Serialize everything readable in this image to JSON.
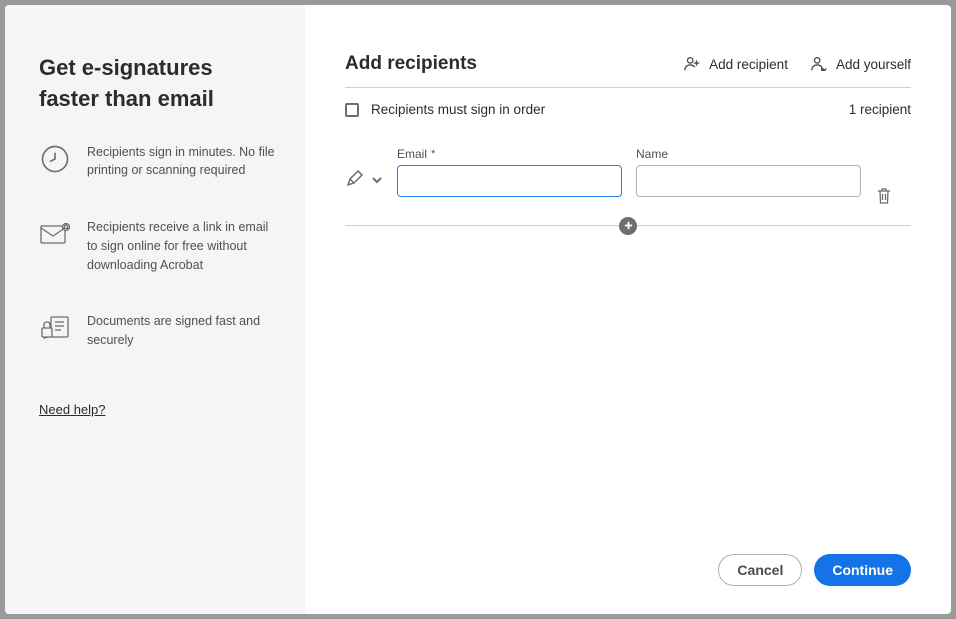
{
  "sidebar": {
    "title": "Get e-signatures faster than email",
    "features": [
      {
        "text": "Recipients sign in minutes. No file printing or scanning required"
      },
      {
        "text": "Recipients receive a link in email to sign online for free without downloading Acrobat"
      },
      {
        "text": "Documents are signed fast and securely"
      }
    ],
    "help_link": "Need help?"
  },
  "main": {
    "title": "Add recipients",
    "actions": {
      "add_recipient": "Add recipient",
      "add_yourself": "Add yourself"
    },
    "sign_order_label": "Recipients must sign in order",
    "recipient_count": "1 recipient",
    "fields": {
      "email_label": "Email",
      "name_label": "Name",
      "email_value": "",
      "name_value": ""
    },
    "footer": {
      "cancel": "Cancel",
      "continue": "Continue"
    }
  }
}
